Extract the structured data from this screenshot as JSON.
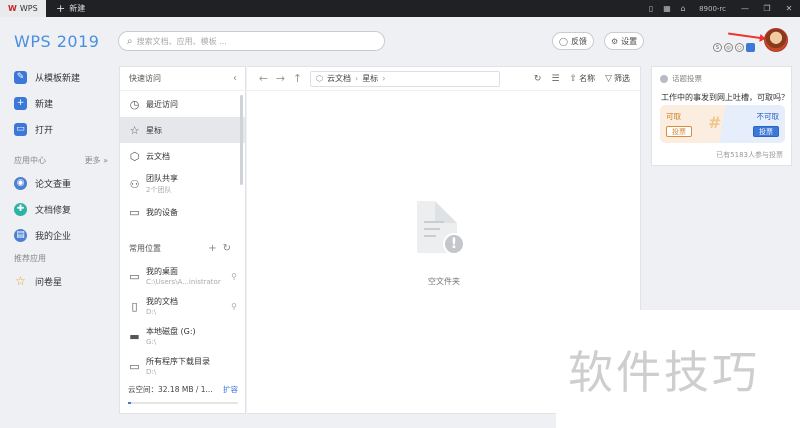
{
  "titlebar": {
    "app_tab": "WPS",
    "new_tab": "新建",
    "user": "8900-rc"
  },
  "header": {
    "brand": "WPS 2019",
    "search_placeholder": "搜索文档、应用、模板 ...",
    "feedback": "反馈",
    "settings": "设置"
  },
  "left_nav": {
    "items": [
      {
        "label": "从模板新建",
        "icon": "template-icon"
      },
      {
        "label": "新建",
        "icon": "plus-icon"
      },
      {
        "label": "打开",
        "icon": "folder-icon"
      }
    ],
    "app_center": "应用中心",
    "more": "更多 »",
    "apps": [
      {
        "label": "论文查重",
        "icon": "paper-check-icon"
      },
      {
        "label": "文档修复",
        "icon": "repair-icon"
      },
      {
        "label": "我的企业",
        "icon": "enterprise-icon"
      }
    ],
    "recommend": "推荐应用",
    "recommend_apps": [
      {
        "label": "问卷星",
        "icon": "star-icon"
      }
    ]
  },
  "quick_access": {
    "title": "快速访问",
    "items": [
      {
        "label": "最近访问",
        "icon": "clock-icon"
      },
      {
        "label": "星标",
        "icon": "star-icon"
      },
      {
        "label": "云文档",
        "icon": "cloud-box-icon"
      },
      {
        "label": "团队共享",
        "sub": "2个团队",
        "icon": "team-icon"
      },
      {
        "label": "我的设备",
        "icon": "device-icon"
      }
    ],
    "common_title": "常用位置",
    "locations": [
      {
        "label": "我的桌面",
        "sub": "C:\\Users\\A...inistrator",
        "icon": "desktop-icon"
      },
      {
        "label": "我的文档",
        "sub": "D:\\",
        "icon": "document-icon"
      },
      {
        "label": "本地磁盘 (G:)",
        "sub": "G:\\",
        "icon": "disk-icon"
      },
      {
        "label": "所有程序下载目录",
        "sub": "D:\\",
        "icon": "folder-icon"
      }
    ],
    "cloud_space": "云空间：32.18 MB / 1...",
    "expand": "扩容",
    "cloud_usage_fraction": 0.03
  },
  "main": {
    "path": [
      "云文档",
      "星标"
    ],
    "sort_label": "名称",
    "filter_label": "筛选",
    "empty_text": "空文件夹"
  },
  "poll": {
    "header": "话题投票",
    "question": "工作中的事发到网上吐槽，可取吗？",
    "option_a": "可取",
    "option_b": "不可取",
    "vote_a": "投票",
    "vote_b": "投票",
    "footer": "已有5183人参与投票"
  },
  "watermark": "软件技巧"
}
